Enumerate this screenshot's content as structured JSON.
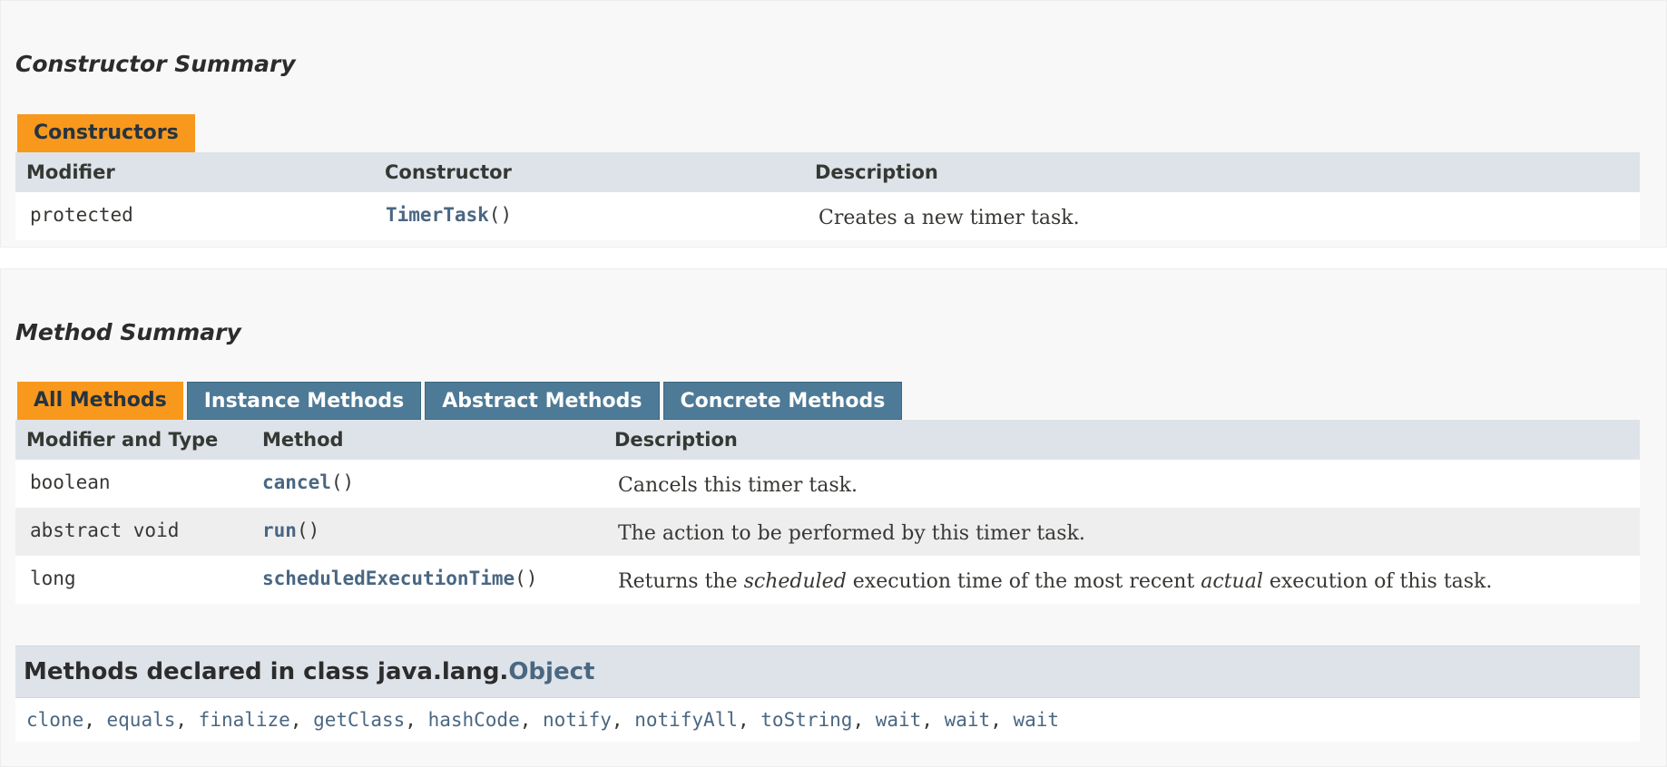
{
  "constructor_summary": {
    "title": "Constructor Summary",
    "tab": "Constructors",
    "headers": [
      "Modifier",
      "Constructor",
      "Description"
    ],
    "rows": [
      {
        "modifier": "protected",
        "name": "TimerTask",
        "params": "()",
        "description": "Creates a new timer task."
      }
    ]
  },
  "method_summary": {
    "title": "Method Summary",
    "tabs": [
      "All Methods",
      "Instance Methods",
      "Abstract Methods",
      "Concrete Methods"
    ],
    "active_tab": "All Methods",
    "headers": [
      "Modifier and Type",
      "Method",
      "Description"
    ],
    "rows": [
      {
        "type": "boolean",
        "name": "cancel",
        "params": "()",
        "description": "Cancels this timer task."
      },
      {
        "type": "abstract void",
        "name": "run",
        "params": "()",
        "description": "The action to be performed by this timer task."
      },
      {
        "type": "long",
        "name": "scheduledExecutionTime",
        "params": "()",
        "desc_1": "Returns the ",
        "desc_em1": "scheduled",
        "desc_2": " execution time of the most recent ",
        "desc_em2": "actual",
        "desc_3": " execution of this task."
      }
    ]
  },
  "inherited": {
    "prefix": "Methods declared in class java.lang.",
    "class_link": "Object",
    "methods": [
      "clone",
      "equals",
      "finalize",
      "getClass",
      "hashCode",
      "notify",
      "notifyAll",
      "toString",
      "wait",
      "wait",
      "wait"
    ],
    "separator": ", "
  },
  "colors": {
    "active_tab": "#f8981d",
    "inactive_tab": "#4d7a97",
    "header_row": "#dee3e9",
    "link": "#4a6782",
    "alt_row": "#eeeeef"
  }
}
